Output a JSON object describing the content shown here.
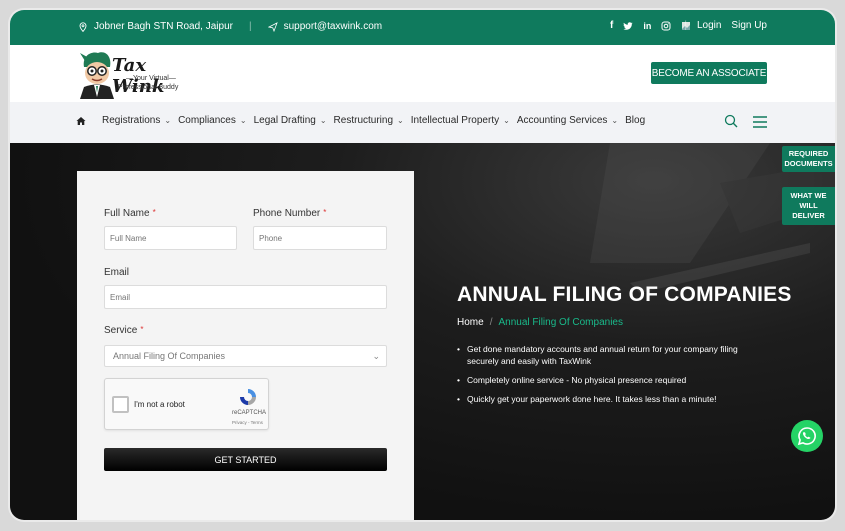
{
  "topbar": {
    "address": "Jobner Bagh STN Road, Jaipur",
    "email": "support@taxwink.com",
    "social_icons": [
      "facebook-icon",
      "twitter-icon",
      "linkedin-icon",
      "instagram-icon",
      "image-icon"
    ],
    "login": "Login",
    "signup": "Sign Up"
  },
  "header": {
    "brand": "Tax Wink",
    "tagline_1": "Your Virtual",
    "tagline_2": "Professional Buddy",
    "associate_button": "BECOME AN ASSOCIATE"
  },
  "nav": {
    "items": [
      {
        "label": "Registrations"
      },
      {
        "label": "Compliances"
      },
      {
        "label": "Legal Drafting"
      },
      {
        "label": "Restructuring"
      },
      {
        "label": "Intellectual Property"
      },
      {
        "label": "Accounting Services"
      },
      {
        "label": "Blog"
      }
    ]
  },
  "form": {
    "full_name_label": "Full Name",
    "full_name_placeholder": "Full Name",
    "phone_label": "Phone Number",
    "phone_placeholder": "Phone",
    "email_label": "Email",
    "email_placeholder": "Email",
    "service_label": "Service",
    "service_value": "Annual Filing Of Companies",
    "required_mark": "*",
    "captcha_text": "I'm not a robot",
    "captcha_brand": "reCAPTCHA",
    "captcha_links": "Privacy - Terms",
    "submit": "GET STARTED"
  },
  "hero": {
    "title": "ANNUAL FILING OF COMPANIES",
    "breadcrumb_home": "Home",
    "breadcrumb_sep": "/",
    "breadcrumb_current": "Annual Filing Of Companies",
    "bullets": [
      "Get done mandatory accounts and annual return for your company filing securely and easily with TaxWink",
      "Completely online service - No physical presence required",
      "Quickly get your paperwork done here. It takes less than a minute!"
    ]
  },
  "side": {
    "required_documents": "REQUIRED DOCUMENTS",
    "what_we_deliver": "WHAT WE WILL DELIVER"
  },
  "colors": {
    "brand_green": "#0f7a5d",
    "accent_green": "#19b98a",
    "whatsapp": "#25d366"
  }
}
